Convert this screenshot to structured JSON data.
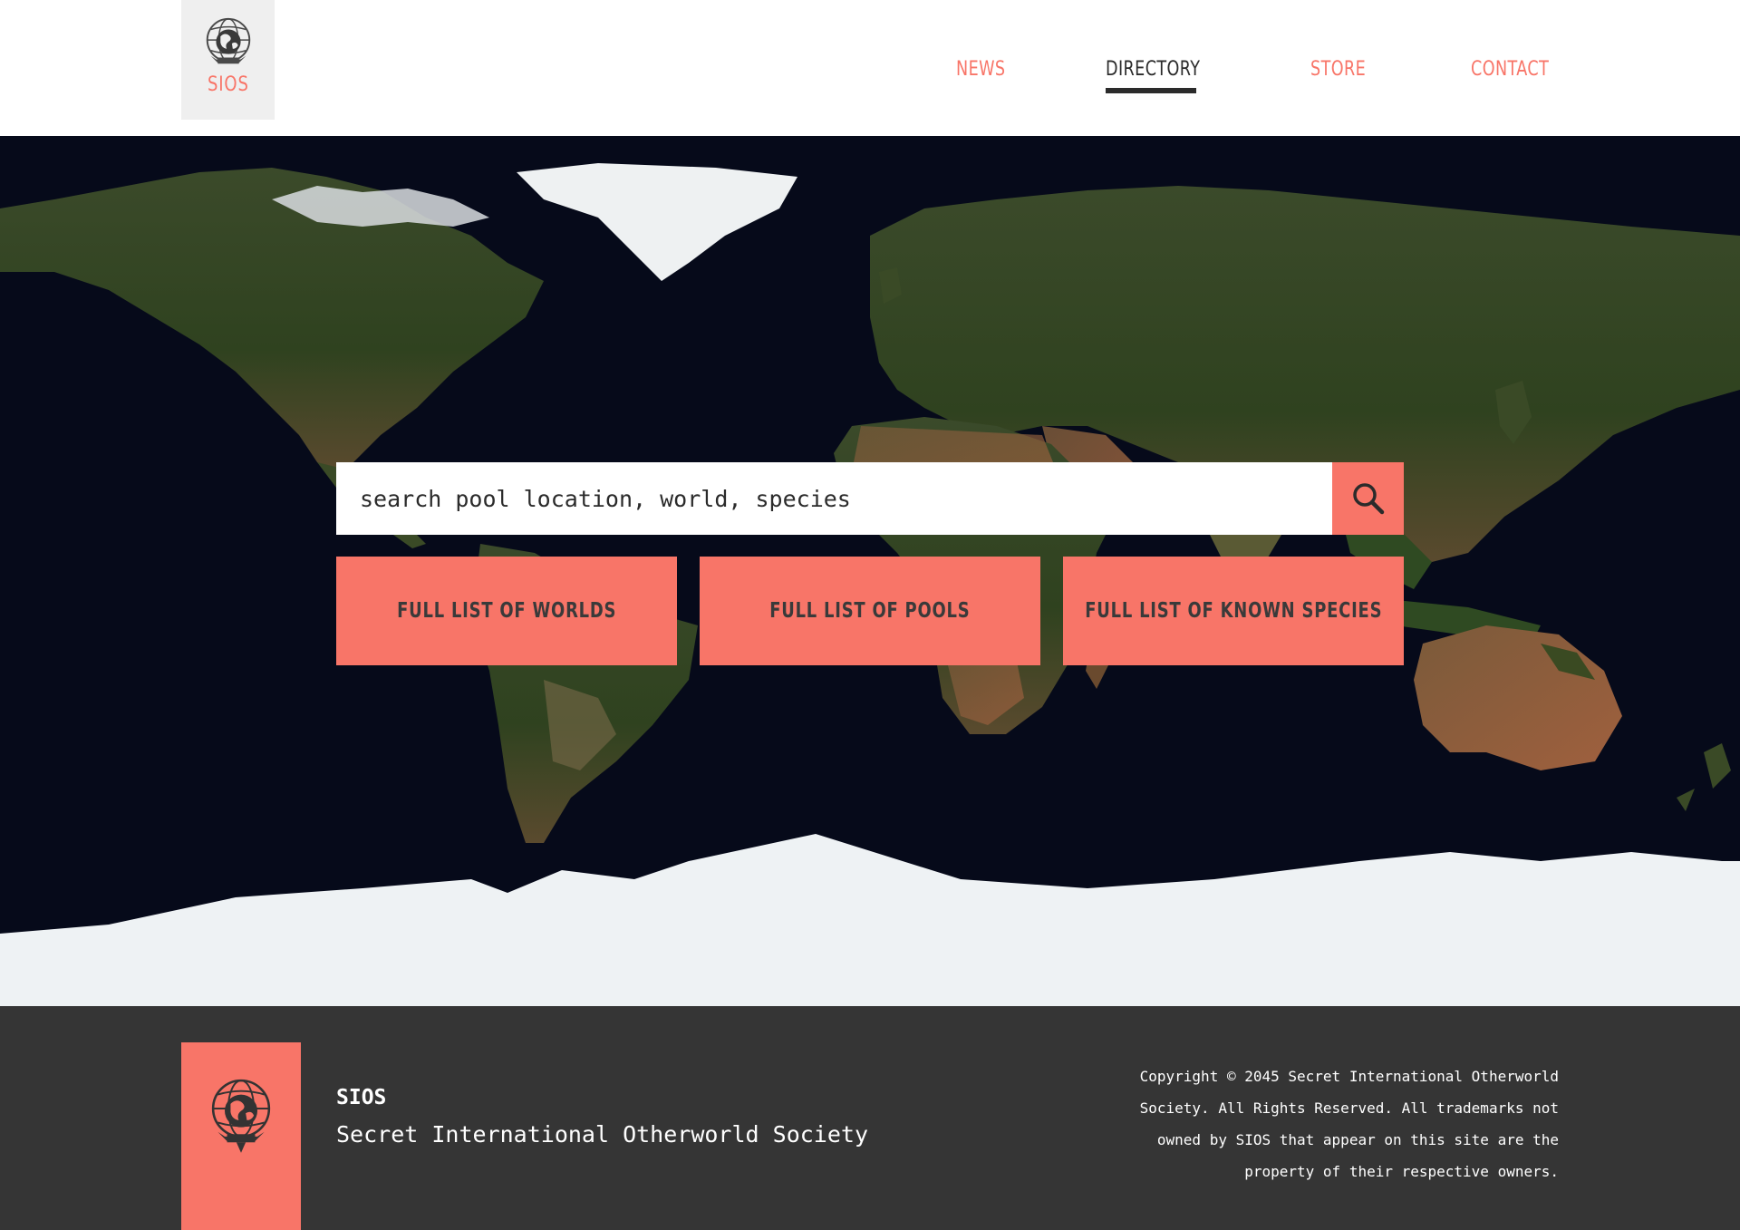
{
  "colors": {
    "accent": "#f87568",
    "dark_text": "#2b2b2b",
    "footer_bg": "#353535",
    "logo_bg": "#efefef",
    "ocean": "#060a1a"
  },
  "header": {
    "logo": {
      "icon": "globe-emblem-icon",
      "text": "SIOS"
    },
    "nav": [
      {
        "label": "NEWS",
        "active": false
      },
      {
        "label": "DIRECTORY",
        "active": true
      },
      {
        "label": "STORE",
        "active": false
      },
      {
        "label": "CONTACT",
        "active": false
      }
    ]
  },
  "hero": {
    "background": "world-map-satellite",
    "search": {
      "placeholder": "search pool location, world, species",
      "value": "",
      "button_icon": "search-icon"
    },
    "buttons": [
      {
        "label": "FULL LIST OF WORLDS"
      },
      {
        "label": "FULL LIST OF POOLS"
      },
      {
        "label": "FULL LIST OF KNOWN SPECIES"
      }
    ]
  },
  "footer": {
    "logo_icon": "globe-emblem-icon",
    "name": "SIOS",
    "full_name": "Secret International Otherworld Society",
    "copyright_lines": [
      "Copyright © 2045 Secret International Otherworld",
      "Society. All Rights Reserved. All trademarks not",
      "owned by SIOS that appear on this site are the",
      "property of their respective owners."
    ]
  }
}
